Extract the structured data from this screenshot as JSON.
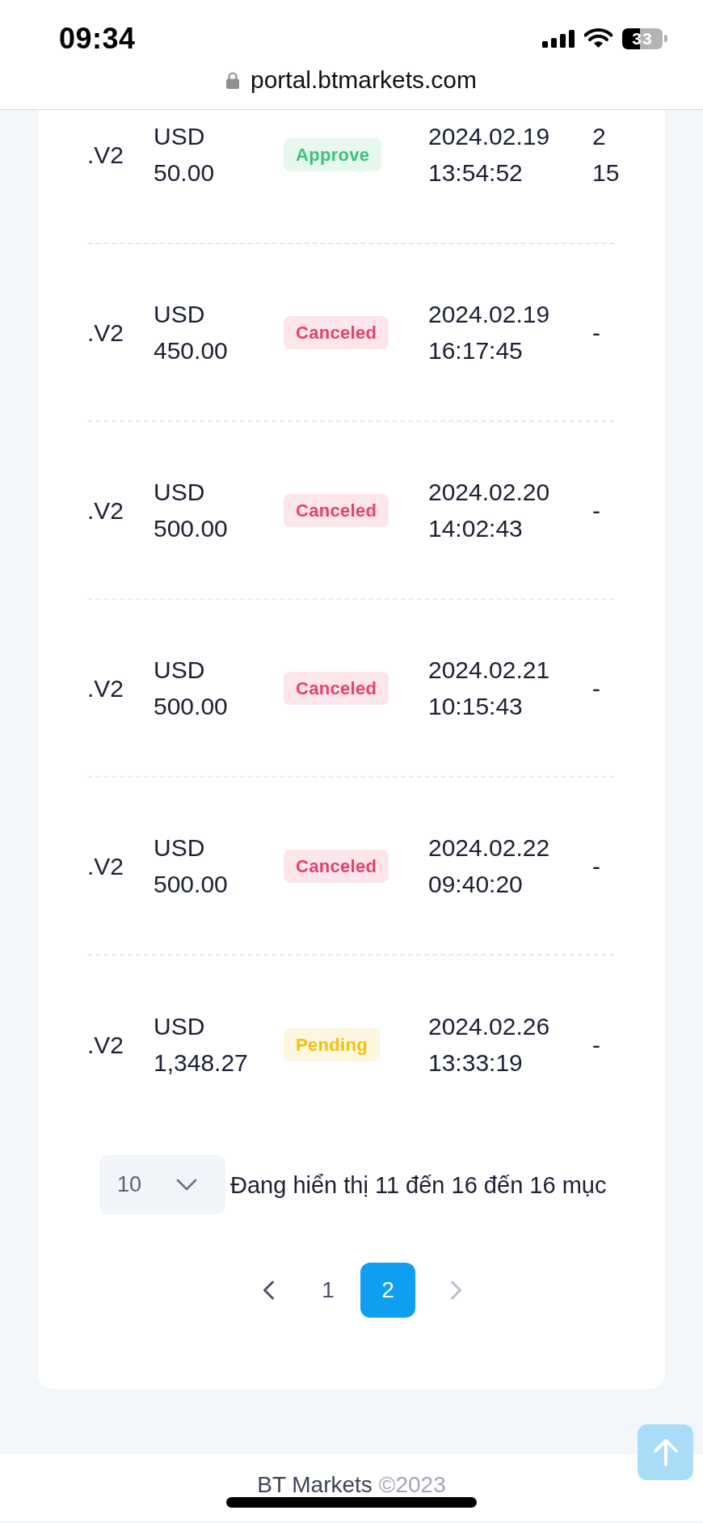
{
  "status_bar": {
    "time": "09:34",
    "battery": "33"
  },
  "address_bar": {
    "url": "portal.btmarkets.com"
  },
  "table": {
    "rows": [
      {
        "column_1": ".V2",
        "column_2": "USD 50.00",
        "column_3": {
          "label": "Approve",
          "color": "#3cc27b"
        },
        "column_4": "2024.02.19 13:54:52",
        "column_5": "2 15"
      },
      {
        "column_1": ".V2",
        "column_2": "USD 450.00",
        "column_3": {
          "label": "Canceled",
          "color": "#e5406a"
        },
        "column_4": "2024.02.19 16:17:45",
        "column_5": "-"
      },
      {
        "column_1": ".V2",
        "column_2": "USD 500.00",
        "column_3": {
          "label": "Canceled",
          "color": "#e5406a"
        },
        "column_4": "2024.02.20 14:02:43",
        "column_5": "-"
      },
      {
        "column_1": ".V2",
        "column_2": "USD 500.00",
        "column_3": {
          "label": "Canceled",
          "color": "#e5406a"
        },
        "column_4": "2024.02.21 10:15:43",
        "column_5": "-"
      },
      {
        "column_1": ".V2",
        "column_2": "USD 500.00",
        "column_3": {
          "label": "Canceled",
          "color": "#e5406a"
        },
        "column_4": "2024.02.22 09:40:20",
        "column_5": "-"
      },
      {
        "column_1": ".V2",
        "column_2": "USD 1,348.27",
        "column_3": {
          "label": "Pending",
          "color": "#f2c10f"
        },
        "column_4": "2024.02.26 13:33:19",
        "column_5": "-"
      }
    ]
  },
  "page_size": {
    "value": "10"
  },
  "summary": "Đang hiển thị 11 đến 16 đến 16 mục",
  "pagination": {
    "prev": {
      "disabled": false
    },
    "pages": [
      {
        "label": "1",
        "selected": false
      },
      {
        "label": "2",
        "selected": true
      }
    ],
    "next": {
      "disabled": true
    }
  },
  "footer": {
    "brand": "BT Markets",
    "copyright": "©2023"
  }
}
